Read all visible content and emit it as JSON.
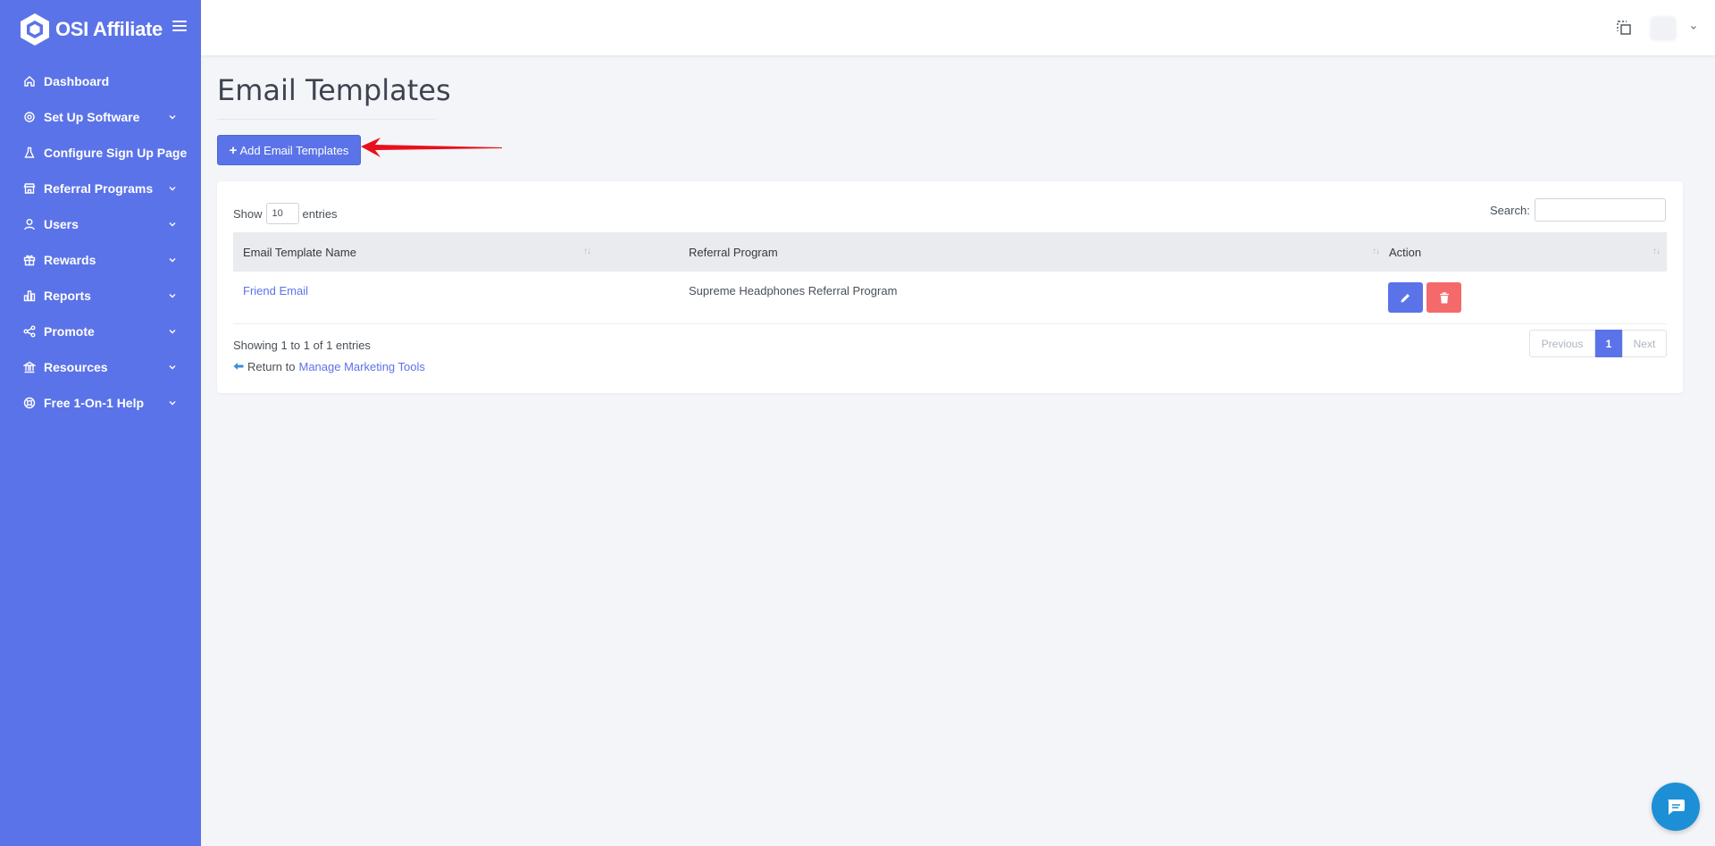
{
  "brand": {
    "name": "OSI Affiliate"
  },
  "sidebar": {
    "items": [
      {
        "label": "Dashboard",
        "icon": "home-icon",
        "has_submenu": false
      },
      {
        "label": "Set Up Software",
        "icon": "settings-icon",
        "has_submenu": true
      },
      {
        "label": "Configure Sign Up Page",
        "icon": "flask-icon",
        "has_submenu": false
      },
      {
        "label": "Referral Programs",
        "icon": "store-icon",
        "has_submenu": true
      },
      {
        "label": "Users",
        "icon": "user-icon",
        "has_submenu": true
      },
      {
        "label": "Rewards",
        "icon": "gift-icon",
        "has_submenu": true
      },
      {
        "label": "Reports",
        "icon": "bar-chart-icon",
        "has_submenu": true
      },
      {
        "label": "Promote",
        "icon": "share-icon",
        "has_submenu": true
      },
      {
        "label": "Resources",
        "icon": "bank-icon",
        "has_submenu": true
      },
      {
        "label": "Free 1-On-1 Help",
        "icon": "lifebuoy-icon",
        "has_submenu": true
      }
    ]
  },
  "page": {
    "title": "Email Templates",
    "add_button_label": "Add Email Templates"
  },
  "table_controls": {
    "show_label": "Show",
    "entries_label": "entries",
    "page_length": "10",
    "search_label": "Search:",
    "search_value": ""
  },
  "table": {
    "columns": [
      "Email Template Name",
      "Referral Program",
      "Action"
    ],
    "rows": [
      {
        "name": "Friend Email",
        "program": "Supreme Headphones Referral Program"
      }
    ]
  },
  "footer": {
    "info": "Showing 1 to 1 of 1 entries",
    "return_prefix": "Return to",
    "return_link": "Manage Marketing Tools",
    "pagination": {
      "previous": "Previous",
      "current": "1",
      "next": "Next"
    }
  },
  "colors": {
    "sidebar": "#5b73e8",
    "primary": "#5b73e8",
    "danger": "#f46a6a",
    "annotation_arrow": "#e8101c",
    "chat": "#1d8fd6"
  }
}
